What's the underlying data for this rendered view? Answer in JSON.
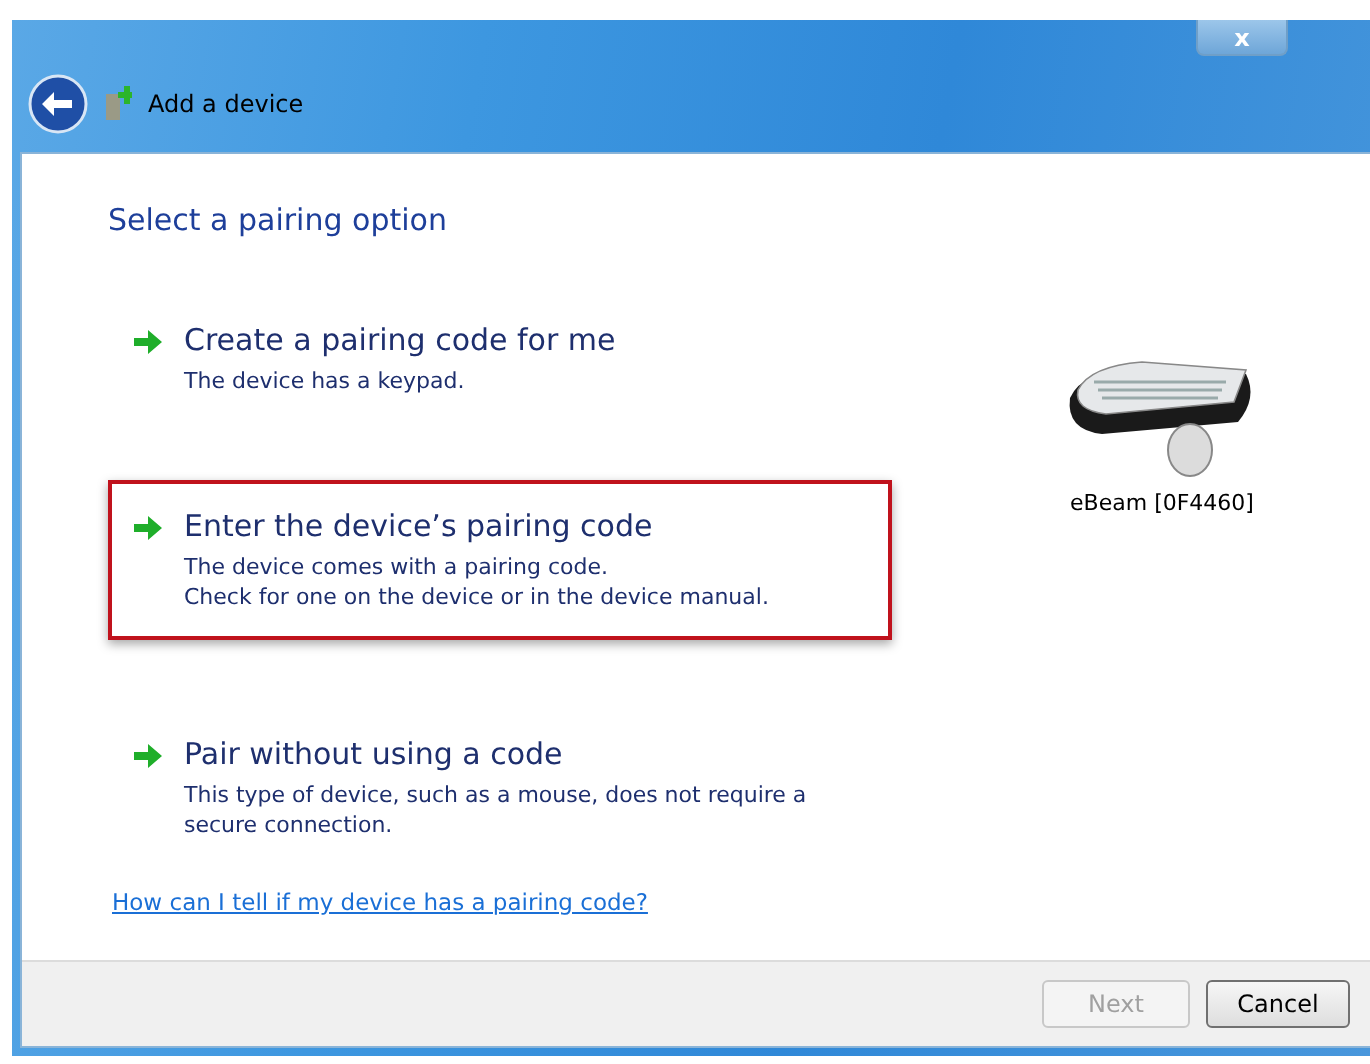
{
  "window": {
    "title": "Add a device",
    "close_label": "x"
  },
  "heading": "Select a pairing option",
  "options": [
    {
      "title": "Create a pairing code for me",
      "lines": [
        "The device has a keypad."
      ],
      "selected": false
    },
    {
      "title": "Enter the device’s pairing code",
      "lines": [
        "The device comes with a pairing code.",
        "Check for one on the device or in the device manual."
      ],
      "selected": true
    },
    {
      "title": "Pair without using a code",
      "lines": [
        "This type of device, such as a mouse, does not require a secure connection."
      ],
      "selected": false
    }
  ],
  "device": {
    "name": "eBeam [0F4460]"
  },
  "help_link": "How can I tell if my device has a pairing code?",
  "buttons": [
    {
      "label": "Next",
      "disabled": true
    },
    {
      "label": "Cancel",
      "disabled": false
    }
  ]
}
